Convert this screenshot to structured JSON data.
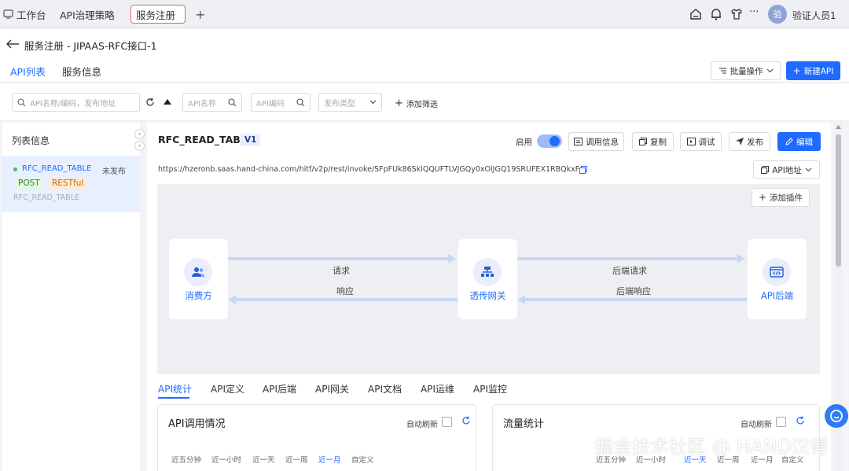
{
  "topbar": {
    "tabs": [
      {
        "label": "工作台"
      },
      {
        "label": "API治理策略"
      },
      {
        "label": "服务注册"
      }
    ],
    "add_tab": "+",
    "more": "···",
    "avatar_text": "验",
    "user_name": "验证人员1"
  },
  "header": {
    "back_title": "服务注册 - JIPAAS-RFC接口-1"
  },
  "page_tabs": [
    {
      "label": "API列表"
    },
    {
      "label": "服务信息"
    }
  ],
  "actions": {
    "batch": "批量操作",
    "new_api": "新建API"
  },
  "filters": {
    "search_placeholder": "API名称/编码，发布地址",
    "api_name_placeholder": "API名称",
    "api_code_placeholder": "API编码",
    "publish_type_placeholder": "发布类型",
    "add_filter": "添加筛选"
  },
  "sidebar": {
    "title": "列表信息",
    "item": {
      "name": "RFC_READ_TABLE",
      "status": "未发布",
      "method": "POST",
      "type": "RESTful",
      "code": "RFC_READ_TABLE"
    }
  },
  "detail": {
    "api_name": "RFC_READ_TABLE",
    "version": "V1",
    "enable_label": "启用",
    "buttons": {
      "call_info": "调用信息",
      "copy": "复制",
      "debug": "调试",
      "publish": "发布",
      "edit": "编辑"
    },
    "url": "https://hzeronb.saas.hand-china.com/hitf/v2p/rest/invoke/SFpFUk86SklQQUFTLVJGQy0xOlJGQ19SRUFEX1RBQkxF",
    "api_address": "API地址",
    "add_plugin": "添加插件"
  },
  "flow": {
    "consumer": "消费方",
    "gateway": "透传网关",
    "backend": "API后端",
    "request": "请求",
    "response": "响应",
    "backend_request": "后端请求",
    "backend_response": "后端响应"
  },
  "sub_tabs": [
    {
      "label": "API统计"
    },
    {
      "label": "API定义"
    },
    {
      "label": "API后端"
    },
    {
      "label": "API网关"
    },
    {
      "label": "API文档"
    },
    {
      "label": "API运维"
    },
    {
      "label": "API监控"
    }
  ],
  "cards": {
    "left": {
      "title": "API调用情况",
      "auto_refresh": "自动刷新",
      "ranges": [
        "近五分钟",
        "近一小时",
        "近一天",
        "近一周",
        "近一月",
        "自定义"
      ]
    },
    "right": {
      "title": "流量统计",
      "auto_refresh": "自动刷新",
      "ranges": [
        "近五分钟",
        "近一小时",
        "近一天",
        "近一周",
        "近一月",
        "自定义"
      ]
    }
  },
  "watermark": "掘金技术社区 @ HAND汉得",
  "colors": {
    "primary": "#1f6bff",
    "post_tag_bg": "#e3f7e3",
    "restful_tag_bg": "#fdebd3"
  }
}
